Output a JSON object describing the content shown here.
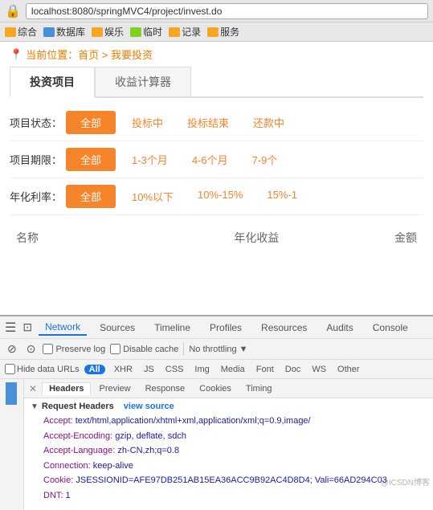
{
  "browser": {
    "address": "localhost:8080/springMVC4/project/invest.do",
    "icon": "🔒"
  },
  "bookmarks": [
    {
      "label": "综合",
      "color": "bk-yellow"
    },
    {
      "label": "数据库",
      "color": "bk-blue"
    },
    {
      "label": "娱乐",
      "color": "bk-yellow"
    },
    {
      "label": "临时",
      "color": "bk-green"
    },
    {
      "label": "记录",
      "color": "bk-yellow"
    },
    {
      "label": "服务",
      "color": "bk-yellow"
    }
  ],
  "breadcrumb": {
    "text": "当前位置：首页 > 我要投资"
  },
  "tabs": [
    {
      "label": "投资项目",
      "active": true
    },
    {
      "label": "收益计算器",
      "active": false
    }
  ],
  "filters": [
    {
      "label": "项目状态：",
      "active_btn": "全部",
      "options": [
        "投标中",
        "投标结束",
        "还款中"
      ]
    },
    {
      "label": "项目期限：",
      "active_btn": "全部",
      "options": [
        "1-3个月",
        "4-6个月",
        "7-9个"
      ]
    },
    {
      "label": "年化利率：",
      "active_btn": "全部",
      "options": [
        "10%以下",
        "10%-15%",
        "15%-1"
      ]
    }
  ],
  "table": {
    "headers": [
      "名称",
      "年化收益",
      "金额"
    ]
  },
  "devtools": {
    "tabs": [
      "Network",
      "Sources",
      "Timeline",
      "Profiles",
      "Resources",
      "Audits",
      "Console"
    ],
    "active_tab": "Network",
    "toolbar2": {
      "preserve_log": "Preserve log",
      "disable_cache": "Disable cache",
      "throttle_label": "No throttling"
    },
    "toolbar3": {
      "hide_data_urls": "Hide data URLs",
      "filter_all": "All",
      "filters": [
        "XHR",
        "JS",
        "CSS",
        "Img",
        "Media",
        "Font",
        "Doc",
        "WS",
        "Other"
      ]
    },
    "request_tabs": [
      "Headers",
      "Preview",
      "Response",
      "Cookies",
      "Timing"
    ],
    "active_req_tab": "Headers",
    "request_headers": {
      "title": "Request Headers",
      "view_source_link": "view source",
      "entries": [
        {
          "key": "Accept:",
          "value": "text/html,application/xhtml+xml,application/xml;q=0.9,image/"
        },
        {
          "key": "Accept-Encoding:",
          "value": "gzip, deflate, sdch"
        },
        {
          "key": "Accept-Language:",
          "value": "zh-CN,zh;q=0.8"
        },
        {
          "key": "Connection:",
          "value": "keep-alive"
        },
        {
          "key": "Cookie:",
          "value": "JSESSIONID=AFE97DB251AB15EA36ACC9B92AC4D8D4; Vali=66AD294C03"
        },
        {
          "key": "DNT:",
          "value": "1"
        }
      ]
    }
  },
  "watermark": "@ICSDN博客"
}
